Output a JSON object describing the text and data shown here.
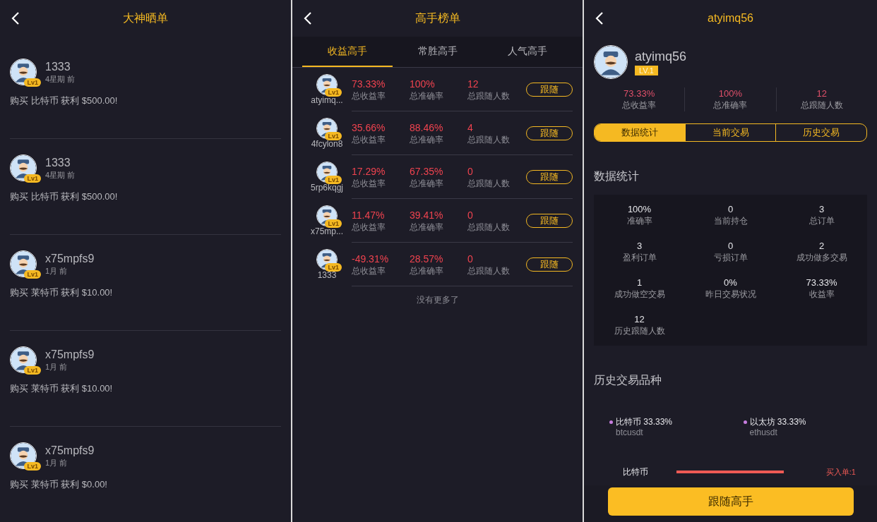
{
  "feed": {
    "title": "大神晒单",
    "posts": [
      {
        "name": "1333",
        "badge": "Lv1",
        "time": "4星期 前",
        "text": "购买 比特币 获利 $500.00!"
      },
      {
        "name": "1333",
        "badge": "Lv1",
        "time": "4星期 前",
        "text": "购买 比特币 获利 $500.00!"
      },
      {
        "name": "x75mpfs9",
        "badge": "Lv1",
        "time": "1月 前",
        "text": "购买 莱特币 获利 $10.00!"
      },
      {
        "name": "x75mpfs9",
        "badge": "Lv1",
        "time": "1月 前",
        "text": "购买 莱特币 获利 $10.00!"
      },
      {
        "name": "x75mpfs9",
        "badge": "Lv1",
        "time": "1月 前",
        "text": "购买 莱特币 获利 $0.00!"
      }
    ]
  },
  "ranking": {
    "title": "高手榜单",
    "tabs": [
      {
        "label": "收益高手",
        "selected": true
      },
      {
        "label": "常胜高手",
        "selected": false
      },
      {
        "label": "人气高手",
        "selected": false
      }
    ],
    "rows": [
      {
        "name": "atyimq...",
        "badge": "Lv1",
        "stats": [
          {
            "value": "73.33%",
            "label": "总收益率"
          },
          {
            "value": "100%",
            "label": "总准确率"
          },
          {
            "value": "12",
            "label": "总跟随人数"
          }
        ],
        "button": "跟随"
      },
      {
        "name": "4fcylon8",
        "badge": "Lv1",
        "stats": [
          {
            "value": "35.66%",
            "label": "总收益率"
          },
          {
            "value": "88.46%",
            "label": "总准确率"
          },
          {
            "value": "4",
            "label": "总跟随人数"
          }
        ],
        "button": "跟随"
      },
      {
        "name": "5rp6kqgj",
        "badge": "Lv1",
        "stats": [
          {
            "value": "17.29%",
            "label": "总收益率"
          },
          {
            "value": "67.35%",
            "label": "总准确率"
          },
          {
            "value": "0",
            "label": "总跟随人数"
          }
        ],
        "button": "跟随"
      },
      {
        "name": "x75mp...",
        "badge": "Lv1",
        "stats": [
          {
            "value": "11.47%",
            "label": "总收益率"
          },
          {
            "value": "39.41%",
            "label": "总准确率"
          },
          {
            "value": "0",
            "label": "总跟随人数"
          }
        ],
        "button": "跟随"
      },
      {
        "name": "1333",
        "badge": "Lv1",
        "stats": [
          {
            "value": "-49.31%",
            "label": "总收益率"
          },
          {
            "value": "28.57%",
            "label": "总准确率"
          },
          {
            "value": "0",
            "label": "总跟随人数"
          }
        ],
        "button": "跟随"
      }
    ],
    "footer": "没有更多了"
  },
  "profile": {
    "title": "atyimq56",
    "name": "atyimq56",
    "badge": "LV.1",
    "stats": [
      {
        "value": "73.33%",
        "label": "总收益率"
      },
      {
        "value": "100%",
        "label": "总准确率"
      },
      {
        "value": "12",
        "label": "总跟随人数"
      }
    ],
    "tabs": [
      {
        "label": "数据统计",
        "selected": true
      },
      {
        "label": "当前交易",
        "selected": false
      },
      {
        "label": "历史交易",
        "selected": false
      }
    ],
    "stats_title": "数据统计",
    "grid": [
      {
        "value": "100%",
        "label": "准确率"
      },
      {
        "value": "0",
        "label": "当前持仓"
      },
      {
        "value": "3",
        "label": "总订单"
      },
      {
        "value": "3",
        "label": "盈利订单"
      },
      {
        "value": "0",
        "label": "亏损订单"
      },
      {
        "value": "2",
        "label": "成功做多交易"
      },
      {
        "value": "1",
        "label": "成功做空交易"
      },
      {
        "value": "0%",
        "label": "昨日交易状况"
      },
      {
        "value": "73.33%",
        "label": "收益率"
      },
      {
        "value": "12",
        "label": "历史跟随人数"
      }
    ],
    "history_title": "历史交易品种",
    "legend": [
      {
        "label": "比特币 33.33%",
        "code": "btcusdt",
        "color": "#c77ddf"
      },
      {
        "label": "以太坊 33.33%",
        "code": "ethusdt",
        "color": "#c77ddf"
      }
    ],
    "trade": {
      "name": "比特币",
      "level": 1,
      "buy": "买入单:1"
    },
    "button": "跟随高手"
  }
}
